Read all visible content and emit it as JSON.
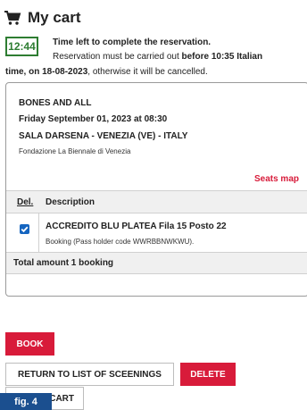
{
  "header": {
    "title": "My cart",
    "icon": "cart-icon"
  },
  "timer": {
    "time": "12:44",
    "line1": "Time left to complete the reservation.",
    "line2_prefix": "Reservation must be carried out ",
    "line2_bold": "before 10:35 Italian",
    "line3_bold": "time, on 18-08-2023",
    "line3_suffix": ", otherwise it will be cancelled.",
    "color": "#2e7d32"
  },
  "event": {
    "title": "BONES AND ALL",
    "date": "Friday September 01, 2023 at 08:30",
    "venue": "SALA DARSENA - VENEZIA (VE) - ITALY",
    "organizer": "Fondazione La Biennale di Venezia",
    "seats_map_link": "Seats map"
  },
  "table": {
    "headers": [
      "Del.",
      "Description"
    ],
    "rows": [
      {
        "checked": true,
        "title": "ACCREDITO BLU PLATEA Fila 15 Posto 22",
        "subtitle": "Booking (Pass holder code WWRBBNWKWU)."
      }
    ],
    "total": "Total amount 1 booking"
  },
  "buttons": {
    "book": "BOOK",
    "return": "RETURN TO LIST OF SCEENINGS",
    "delete": "DELETE",
    "empty_cart": "CART"
  },
  "figure_label": "fig. 4",
  "colors": {
    "accent": "#d81b3a",
    "checkbox": "#1565c0",
    "badge": "#1b4f8f"
  }
}
